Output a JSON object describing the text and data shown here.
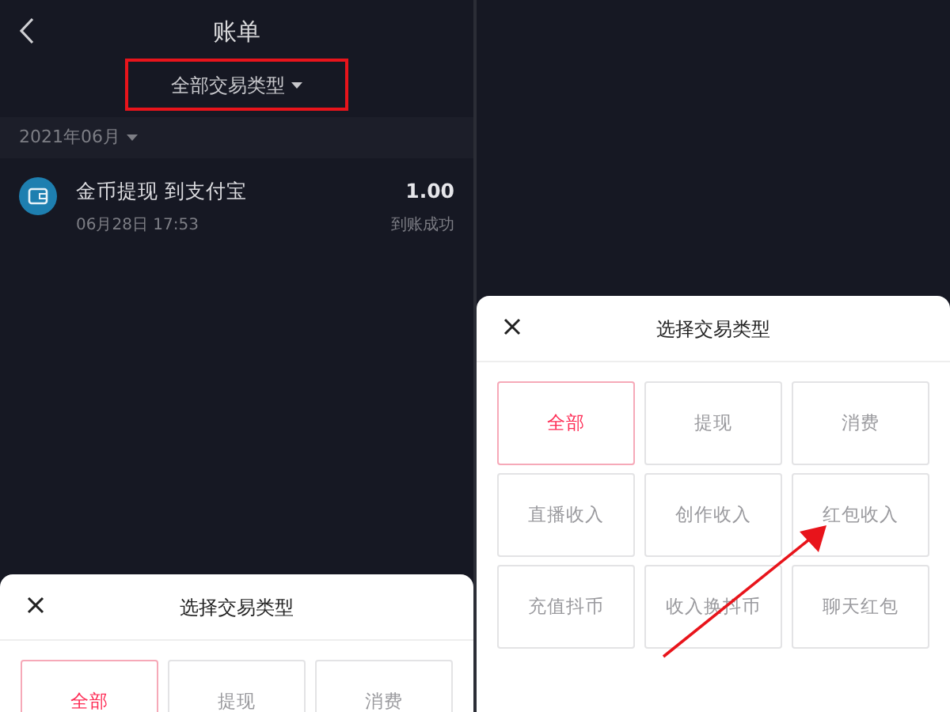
{
  "left_screen": {
    "header": {
      "title": "账单"
    },
    "filter": {
      "label": "全部交易类型"
    },
    "month": {
      "label": "2021年06月"
    },
    "transactions": [
      {
        "title": "金币提现 到支付宝",
        "date": "06月28日 17:53",
        "amount": "1.00",
        "status": "到账成功"
      }
    ],
    "sheet": {
      "title": "选择交易类型",
      "options": [
        {
          "label": "全部",
          "selected": true
        },
        {
          "label": "提现",
          "selected": false
        },
        {
          "label": "消费",
          "selected": false
        }
      ]
    }
  },
  "right_screen": {
    "sheet": {
      "title": "选择交易类型",
      "options": [
        {
          "label": "全部",
          "selected": true
        },
        {
          "label": "提现",
          "selected": false
        },
        {
          "label": "消费",
          "selected": false
        },
        {
          "label": "直播收入",
          "selected": false
        },
        {
          "label": "创作收入",
          "selected": false
        },
        {
          "label": "红包收入",
          "selected": false
        },
        {
          "label": "充值抖币",
          "selected": false
        },
        {
          "label": "收入换抖币",
          "selected": false
        },
        {
          "label": "聊天红包",
          "selected": false
        }
      ]
    }
  }
}
